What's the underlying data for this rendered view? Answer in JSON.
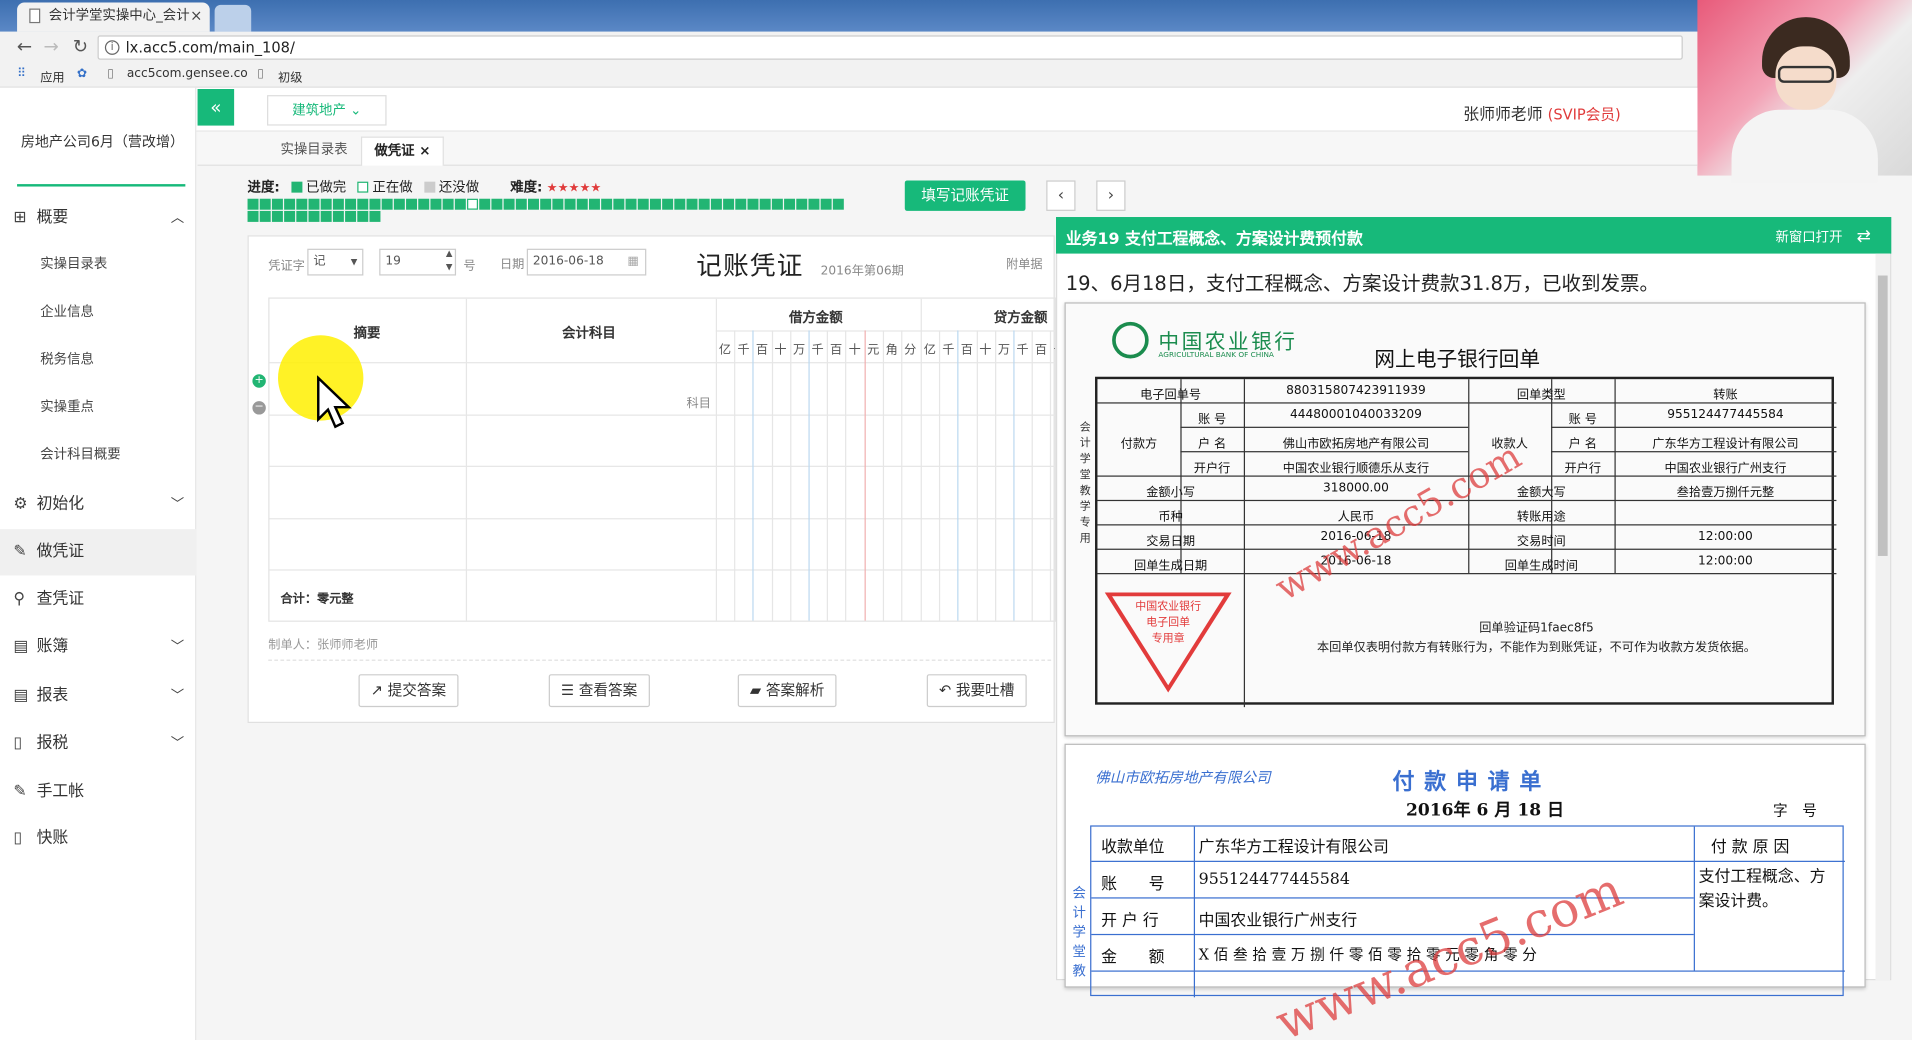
{
  "browser": {
    "tab_title": "会计学堂实操中心_会计",
    "tab_close": "×",
    "url": "lx.acc5.com/main_108/",
    "bookmarks": [
      "应用",
      "acc5com.gensee.co",
      "初级"
    ]
  },
  "header": {
    "collapse_icon": "«",
    "sector": "建筑地产",
    "user_name": "张师师老师",
    "user_vip": "(SVIP会员)"
  },
  "sidebar": {
    "company": "房地产公司6月（营改增）",
    "items": [
      {
        "label": "概要",
        "icon": "grid-icon",
        "glyph": "⊞",
        "chev": "︿"
      },
      {
        "label": "初始化",
        "icon": "gear-icon",
        "glyph": "⚙",
        "chev": "﹀"
      },
      {
        "label": "做凭证",
        "icon": "pencil-icon",
        "glyph": "✎",
        "chev": ""
      },
      {
        "label": "查凭证",
        "icon": "search-icon",
        "glyph": "⚲",
        "chev": ""
      },
      {
        "label": "账簿",
        "icon": "book-icon",
        "glyph": "▤",
        "chev": "﹀"
      },
      {
        "label": "报表",
        "icon": "report-icon",
        "glyph": "▤",
        "chev": "﹀"
      },
      {
        "label": "报税",
        "icon": "doc-icon",
        "glyph": "▯",
        "chev": "﹀"
      },
      {
        "label": "手工帐",
        "icon": "pencil-icon",
        "glyph": "✎",
        "chev": ""
      },
      {
        "label": "快账",
        "icon": "doc-icon",
        "glyph": "▯",
        "chev": ""
      }
    ],
    "sub_items": [
      "实操目录表",
      "企业信息",
      "税务信息",
      "实操重点",
      "会计科目概要"
    ]
  },
  "content_tabs": [
    "实操目录表",
    "做凭证"
  ],
  "content_tab_close": "×",
  "progress": {
    "label": "进度:",
    "done": "已做完",
    "doing": "正在做",
    "todo": "还没做",
    "difficulty_label": "难度:",
    "difficulty_stars": "★★★★★",
    "total_blocks": 60,
    "current_index": 18,
    "done_color": "#22b573"
  },
  "actions": {
    "fill_voucher": "填写记账凭证",
    "prev": "‹",
    "next": "›"
  },
  "voucher": {
    "word_label": "凭证字",
    "word_value": "记",
    "number_value": "19",
    "number_suffix": "号",
    "date_label": "日期",
    "date_value": "2016-06-18",
    "title": "记账凭证",
    "period": "2016年第06期",
    "attach_label": "附单据",
    "col_summary": "摘要",
    "col_account": "会计科目",
    "col_debit": "借方金额",
    "col_credit": "贷方金额",
    "account_placeholder": "科目",
    "digits": [
      "亿",
      "千",
      "百",
      "十",
      "万",
      "千",
      "百",
      "十",
      "元",
      "角",
      "分"
    ],
    "total": "合计：零元整",
    "maker": "制单人：张师师老师",
    "add_icon": "+",
    "remove_icon": "−"
  },
  "buttons": [
    {
      "label": "提交答案",
      "icon": "↗"
    },
    {
      "label": "查看答案",
      "icon": "☰"
    },
    {
      "label": "答案解析",
      "icon": "▰"
    },
    {
      "label": "我要吐槽",
      "icon": "↶"
    }
  ],
  "task": {
    "title": "业务19 支付工程概念、方案设计费预付款",
    "new_window": "新窗口打开",
    "description": "19、6月18日，支付工程概念、方案设计费款31.8万，已收到发票。"
  },
  "receipt1": {
    "bank_name": "中国农业银行",
    "bank_en": "AGRICULTURAL BANK OF CHINA",
    "title": "网上电子银行回单",
    "side_text": "会计学堂教学专用",
    "watermark": "www.acc5.com",
    "rows": {
      "no_label": "电子回单号",
      "no_value": "880315807423911939",
      "type_label": "回单类型",
      "type_value": "转账",
      "payer_label": "付款方",
      "payee_label": "收款人",
      "acct_label": "账 号",
      "payer_acct": "44480001040033209",
      "payee_acct": "955124477445584",
      "name_label": "户 名",
      "payer_name": "佛山市欧拓房地产有限公司",
      "payee_name": "广东华方工程设计有限公司",
      "bank_label": "开户行",
      "payer_bank": "中国农业银行顺德乐从支行",
      "payee_bank": "中国农业银行广州支行",
      "amt_small_label": "金额小写",
      "amt_small": "318000.00",
      "amt_big_label": "金额大写",
      "amt_big": "叁拾壹万捌仟元整",
      "currency_label": "币种",
      "currency": "人民币",
      "purpose_label": "转账用途",
      "tx_date_label": "交易日期",
      "tx_date": "2016-06-18",
      "tx_time_label": "交易时间",
      "tx_time": "12:00:00",
      "gen_date_label": "回单生成日期",
      "gen_date": "2016-06-18",
      "gen_time_label": "回单生成时间",
      "gen_time": "12:00:00"
    },
    "stamp": "中国农业银行\n电子回单\n专用章",
    "verify_code": "回单验证码1faec8f5",
    "note": "本回单仅表明付款方有转账行为，不能作为到账凭证，不可作为收款方发货依据。"
  },
  "receipt2": {
    "company": "佛山市欧拓房地产有限公司",
    "title": "付款申请单",
    "date": "2016年 6 月 18 日",
    "no_label": "字　号",
    "side_text": "会计学堂教",
    "payee_label": "收款单位",
    "payee": "广东华方工程设计有限公司",
    "reason_label": "付 款 原 因",
    "reason": "支付工程概念、方案设计费。",
    "acct_label": "账　　号",
    "acct": "955124477445584",
    "bank_label": "开 户 行",
    "bank": "中国农业银行广州支行",
    "amount_label": "金　　额",
    "amount": "X 佰 叁 拾 壹 万 捌 仟 零 佰 零 拾 零 元 零 角 零 分",
    "watermark": "www.acc5.com"
  }
}
